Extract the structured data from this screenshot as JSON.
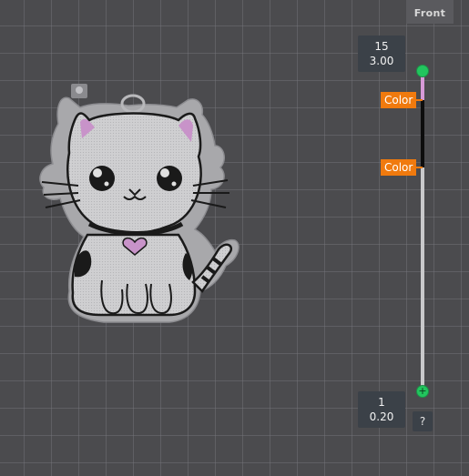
{
  "view": {
    "label": "Front"
  },
  "layer_slider": {
    "top": {
      "layer": "15",
      "height": "3.00"
    },
    "bottom": {
      "layer": "1",
      "height": "0.20"
    },
    "color_tags": [
      "Color",
      "Color"
    ],
    "help": "?",
    "colors": {
      "handle": "#22c55e",
      "tag": "#f07a0e",
      "pink_segment": "#d79ad8",
      "black_segment": "#0d0d0d"
    }
  },
  "model": {
    "name_icon": "cat-keychain-model"
  }
}
